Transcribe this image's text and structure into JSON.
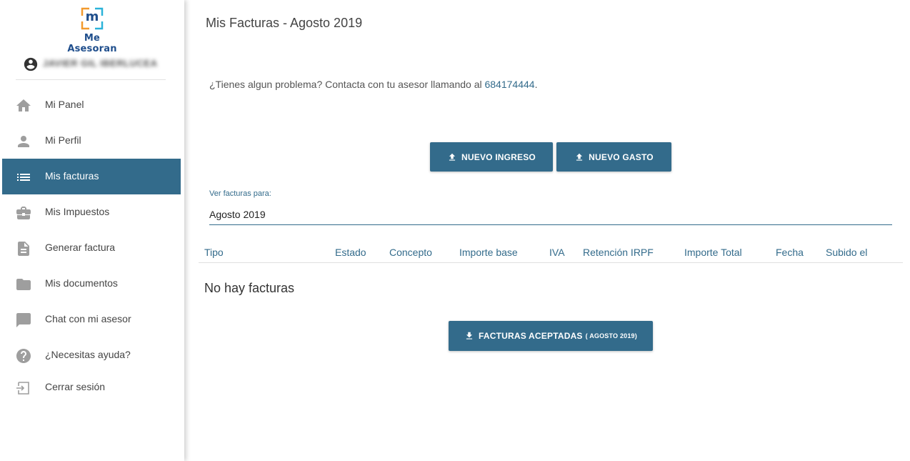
{
  "app": {
    "logo_text": "Me Asesoran",
    "logo_letter": "m",
    "user_name": "JAVIER GIL IBERLUCEA"
  },
  "colors": {
    "primary": "#336b8b",
    "logo_blue": "#1f4e8c",
    "logo_orange": "#f29a2e",
    "logo_cyan": "#2bb3d9"
  },
  "sidebar": {
    "items": [
      {
        "label": "Mi Panel",
        "icon": "home-icon"
      },
      {
        "label": "Mi Perfil",
        "icon": "person-icon"
      },
      {
        "label": "Mis facturas",
        "icon": "list-icon",
        "active": true
      },
      {
        "label": "Mis Impuestos",
        "icon": "briefcase-icon"
      },
      {
        "label": "Generar factura",
        "icon": "document-icon"
      },
      {
        "label": "Mis documentos",
        "icon": "folder-icon"
      },
      {
        "label": "Chat con mi asesor",
        "icon": "chat-icon"
      },
      {
        "label": "¿Necesitas ayuda?",
        "icon": "help-icon"
      },
      {
        "label": "Cerrar sesión",
        "icon": "logout-icon"
      }
    ]
  },
  "main": {
    "title": "Mis Facturas - Agosto 2019",
    "help_text": "¿Tienes algun problema? Contacta con tu asesor llamando al ",
    "help_phone": "684174444",
    "help_suffix": ".",
    "buttons": {
      "new_income": "NUEVO INGRESO",
      "new_expense": "NUEVO GASTO",
      "accepted": "FACTURAS ACEPTADAS",
      "accepted_period": "( AGOSTO 2019)"
    },
    "select": {
      "label": "Ver facturas para:",
      "value": "Agosto 2019"
    },
    "table": {
      "columns": [
        "Tipo",
        "Estado",
        "Concepto",
        "Importe base",
        "IVA",
        "Retención IRPF",
        "Importe Total",
        "Fecha",
        "Subido el"
      ],
      "empty_text": "No hay facturas"
    }
  }
}
